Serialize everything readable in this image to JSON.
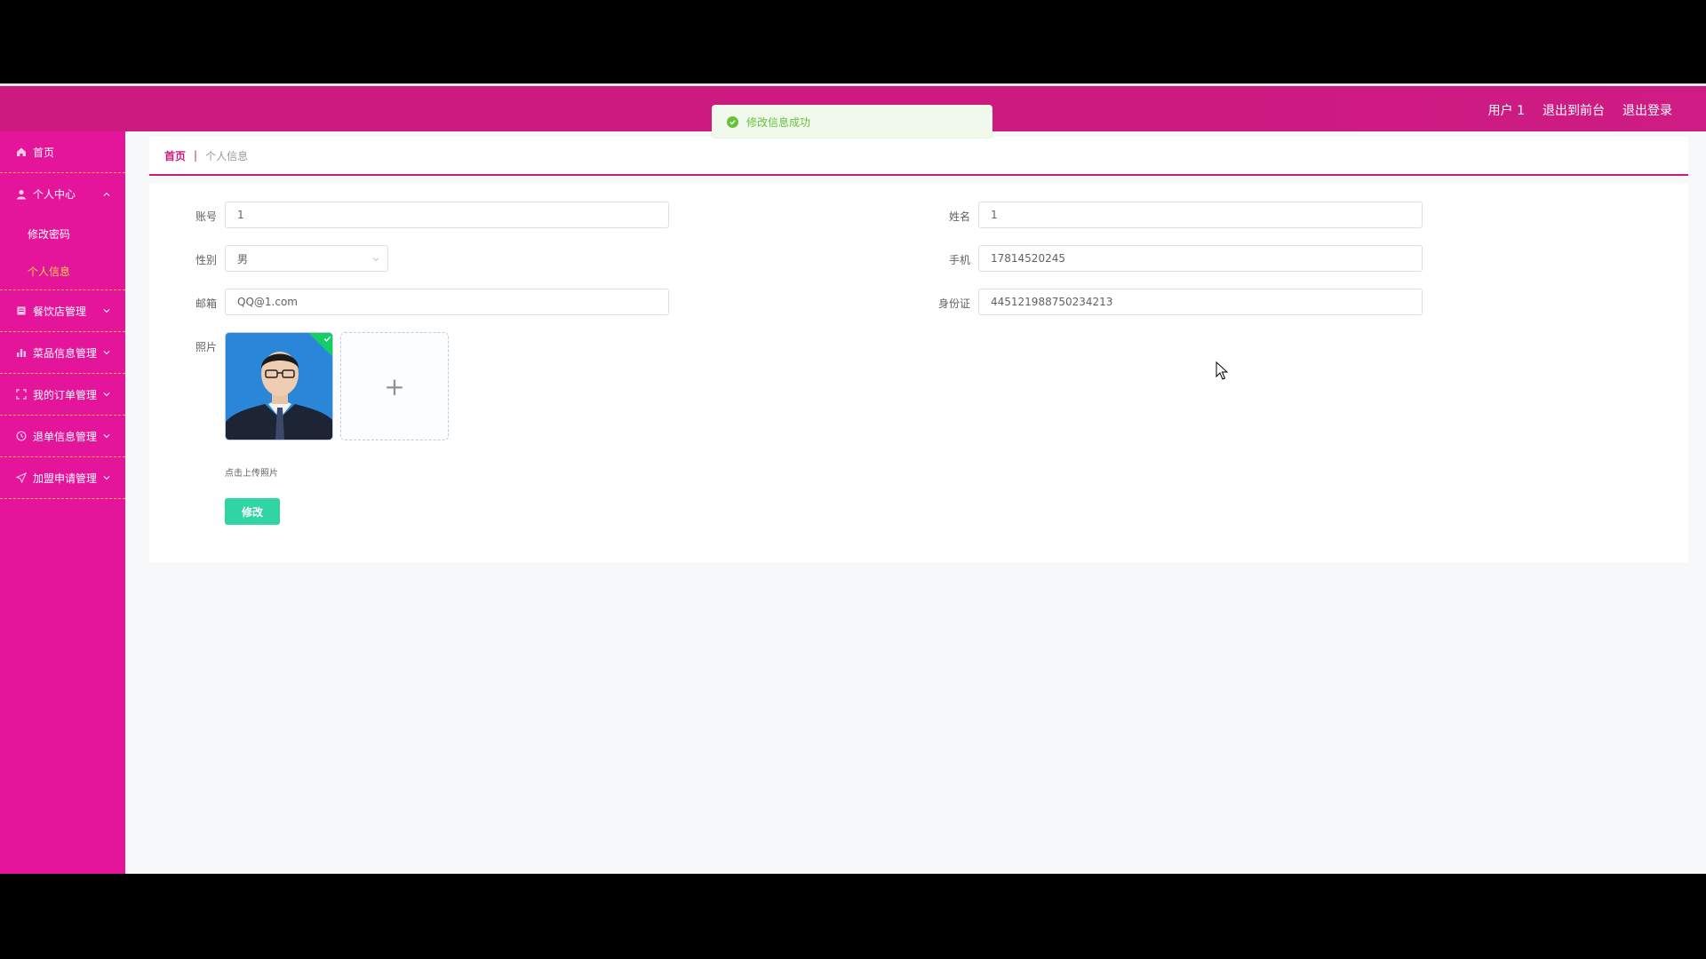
{
  "header": {
    "links": [
      "用户 1",
      "退出到前台",
      "退出登录"
    ]
  },
  "toast": {
    "message": "修改信息成功",
    "color": "#67c23a"
  },
  "sidebar": {
    "home": "首页",
    "personal_center": "个人中心",
    "personal_sub": [
      "修改密码",
      "个人信息"
    ],
    "groups": [
      "餐饮店管理",
      "菜品信息管理",
      "我的订单管理",
      "退单信息管理",
      "加盟申请管理"
    ]
  },
  "breadcrumb": {
    "home": "首页",
    "sep": "|",
    "current": "个人信息"
  },
  "form": {
    "account": {
      "label": "账号",
      "value": "1"
    },
    "name": {
      "label": "姓名",
      "value": "1"
    },
    "gender": {
      "label": "性别",
      "value": "男"
    },
    "phone": {
      "label": "手机",
      "value": "17814520245"
    },
    "email": {
      "label": "邮箱",
      "value": "QQ@1.com"
    },
    "idcard": {
      "label": "身份证",
      "value": "445121988750234213"
    },
    "photo": {
      "label": "照片",
      "hint": "点击上传照片",
      "add": "+"
    },
    "submit_label": "修改"
  },
  "colors": {
    "brand": "#e4149b",
    "topbar": "#cc1a80",
    "submit": "#2fd5a3",
    "active_sub": "#ffd04b"
  }
}
